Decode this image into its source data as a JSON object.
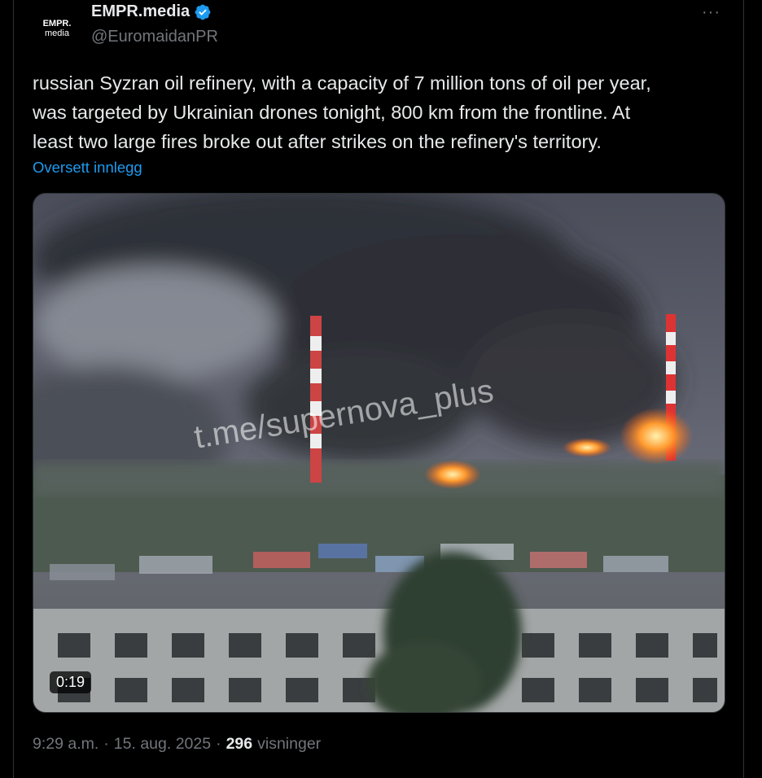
{
  "author": {
    "avatar_line1": "EMPR.",
    "avatar_line2": "media",
    "name": "EMPR.media",
    "handle": "@EuromaidanPR",
    "verified_icon": "verified-badge-icon",
    "verified_color": "#1d9bf0"
  },
  "more_label": "···",
  "tweet": {
    "lines": [
      "russian Syzran oil refinery, with a capacity of 7 million tons of oil per year,",
      "was targeted by Ukrainian drones tonight, 800 km from the frontline. At",
      "least two large fires broke out after strikes on the refinery's territory."
    ],
    "translate_label": "Oversett innlegg"
  },
  "media": {
    "watermark": "t.me/supernova_plus",
    "duration": "0:19"
  },
  "meta": {
    "time": "9:29 a.m.",
    "separator": "·",
    "date": "15. aug. 2025",
    "views_count": "296",
    "views_label": "visninger"
  },
  "colors": {
    "background": "#000000",
    "text": "#e7e9ea",
    "muted": "#71767b",
    "link": "#1d9bf0"
  }
}
